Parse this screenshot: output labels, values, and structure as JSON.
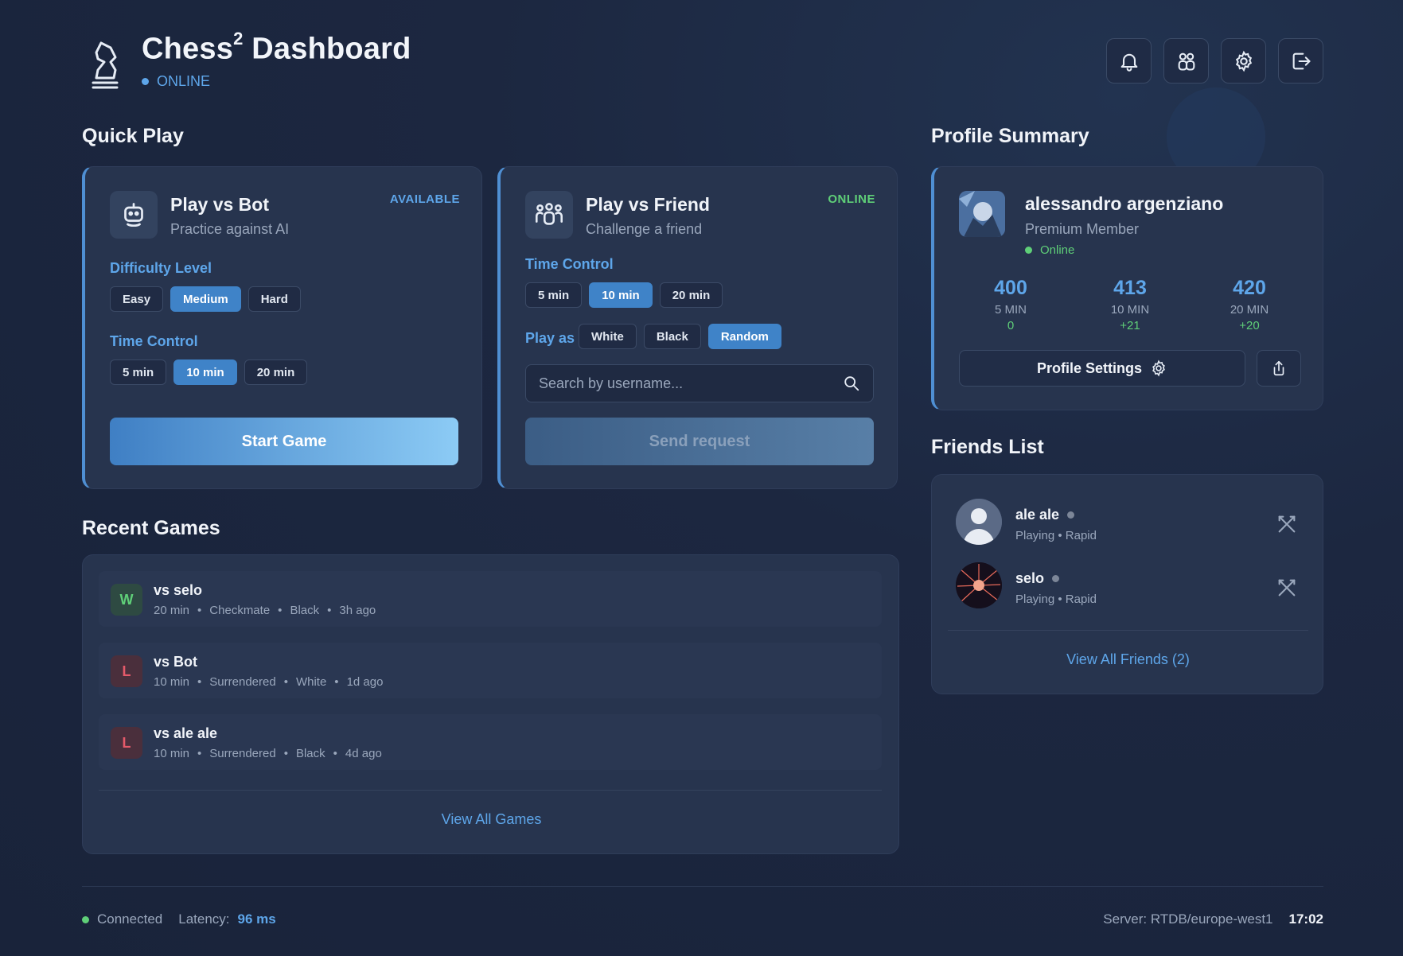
{
  "header": {
    "title": "Chess",
    "title_sup": "2",
    "title_suffix": " Dashboard",
    "status": "ONLINE",
    "buttons": [
      "bell-icon",
      "friends-icon",
      "gear-icon",
      "logout-icon"
    ]
  },
  "quick_play": {
    "title": "Quick Play",
    "bot": {
      "title": "Play vs Bot",
      "subtitle": "Practice against AI",
      "badge": "AVAILABLE",
      "difficulty_label": "Difficulty Level",
      "difficulty": [
        "Easy",
        "Medium",
        "Hard"
      ],
      "difficulty_selected": "Medium",
      "time_label": "Time Control",
      "time": [
        "5 min",
        "10 min",
        "20 min"
      ],
      "time_selected": "10 min",
      "start": "Start Game"
    },
    "friend": {
      "title": "Play vs Friend",
      "subtitle": "Challenge a friend",
      "badge": "ONLINE",
      "time_label": "Time Control",
      "time": [
        "5 min",
        "10 min",
        "20 min"
      ],
      "time_selected": "10 min",
      "play_as_label": "Play as",
      "play_as": [
        "White",
        "Black",
        "Random"
      ],
      "play_as_selected": "Random",
      "search_placeholder": "Search by username...",
      "send": "Send request"
    }
  },
  "recent_games": {
    "title": "Recent Games",
    "games": [
      {
        "result": "W",
        "opponent": "vs selo",
        "time": "20 min",
        "reason": "Checkmate",
        "color": "Black",
        "ago": "3h ago"
      },
      {
        "result": "L",
        "opponent": "vs Bot",
        "time": "10 min",
        "reason": "Surrendered",
        "color": "White",
        "ago": "1d ago"
      },
      {
        "result": "L",
        "opponent": "vs ale ale",
        "time": "10 min",
        "reason": "Surrendered",
        "color": "Black",
        "ago": "4d ago"
      }
    ],
    "view_all": "View All Games"
  },
  "profile": {
    "title": "Profile Summary",
    "name": "alessandro argenziano",
    "membership": "Premium Member",
    "status": "Online",
    "stats": [
      {
        "value": "400",
        "label": "5 MIN",
        "delta": "0"
      },
      {
        "value": "413",
        "label": "10 MIN",
        "delta": "+21"
      },
      {
        "value": "420",
        "label": "20 MIN",
        "delta": "+20"
      }
    ],
    "settings": "Profile Settings"
  },
  "friends": {
    "title": "Friends List",
    "list": [
      {
        "name": "ale ale",
        "status": "Playing • Rapid"
      },
      {
        "name": "selo",
        "status": "Playing • Rapid"
      }
    ],
    "view_all": "View All Friends (2)"
  },
  "footer": {
    "connected": "Connected",
    "latency_label": "Latency:",
    "latency": "96 ms",
    "server": "Server: RTDB/europe-west1",
    "clock": "17:02"
  },
  "colors": {
    "accent": "#5ea6ea",
    "selected": "#3f83c8",
    "win": "#5fcf78",
    "loss": "#e55a6a"
  }
}
